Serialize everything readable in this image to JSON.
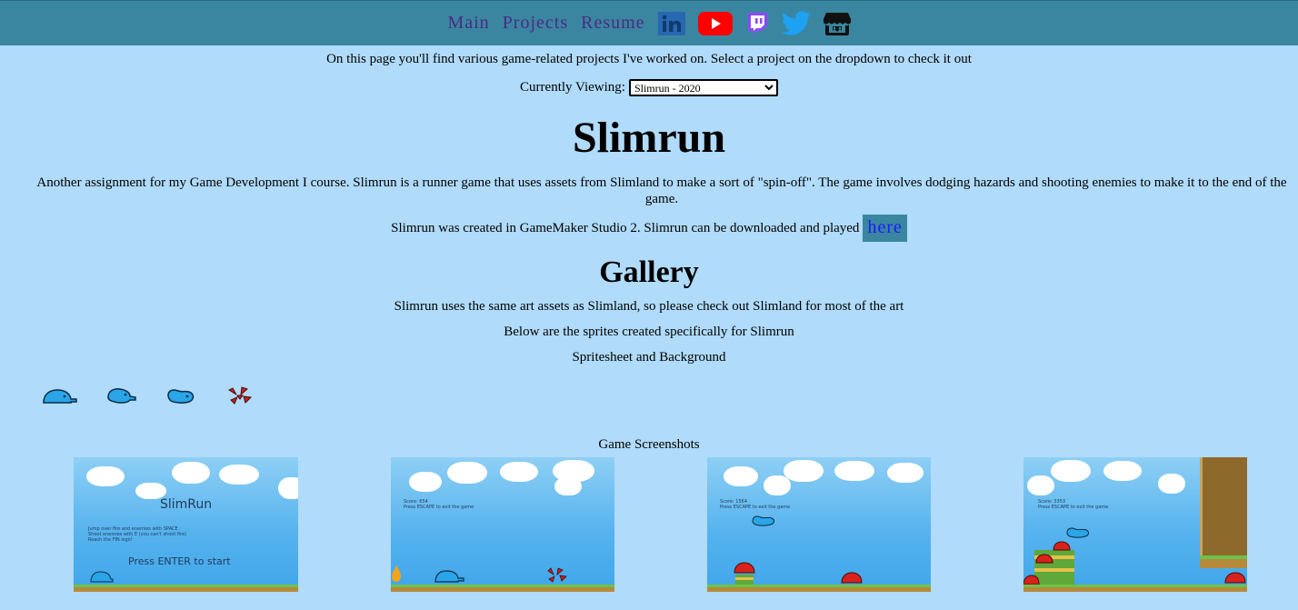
{
  "nav": {
    "links": [
      "Main",
      "Projects",
      "Resume"
    ],
    "icons": [
      "linkedin-icon",
      "youtube-icon",
      "twitch-icon",
      "twitter-icon",
      "itchio-icon"
    ]
  },
  "intro_text": "On this page you'll find various game-related projects I've worked on. Select a project on the dropdown to check it out",
  "viewing": {
    "label": "Currently Viewing:",
    "selected": "Slimrun - 2020"
  },
  "project": {
    "title": "Slimrun",
    "description": "Another assignment for my Game Development I course. Slimrun is a runner game that uses assets from Slimland to make a sort of \"spin-off\". The game involves dodging hazards and shooting enemies to make it to the end of the game.",
    "created_text": "Slimrun was created in GameMaker Studio 2. Slimrun can be downloaded and played",
    "here_label": "here"
  },
  "gallery": {
    "heading": "Gallery",
    "line1": "Slimrun uses the same art assets as Slimland, so please check out Slimland for most of the art",
    "line2": "Below are the sprites created specifically for Slimrun",
    "line3": "Spritesheet and Background",
    "screens_label": "Game Screenshots",
    "screenshots": [
      {
        "title": "SlimRun",
        "lines": [
          "Jump over fire and enemies with SPACE",
          "Shoot enemies with E (you can't shoot fire)",
          "Reach the FIN sign!"
        ],
        "prompt": "Press ENTER to start"
      },
      {
        "score": "Score: 654",
        "hint": "Press ESCAPE to exit the game"
      },
      {
        "score": "Score: 1564",
        "hint": "Press ESCAPE to exit the game"
      },
      {
        "score": "Score: 3353",
        "hint": "Press ESCAPE to exit the game"
      }
    ]
  },
  "colors": {
    "background": "#b0dbfa",
    "navbar": "#3a86a0",
    "nav_link": "#4b2a86",
    "here_link": "#1a1aff"
  }
}
